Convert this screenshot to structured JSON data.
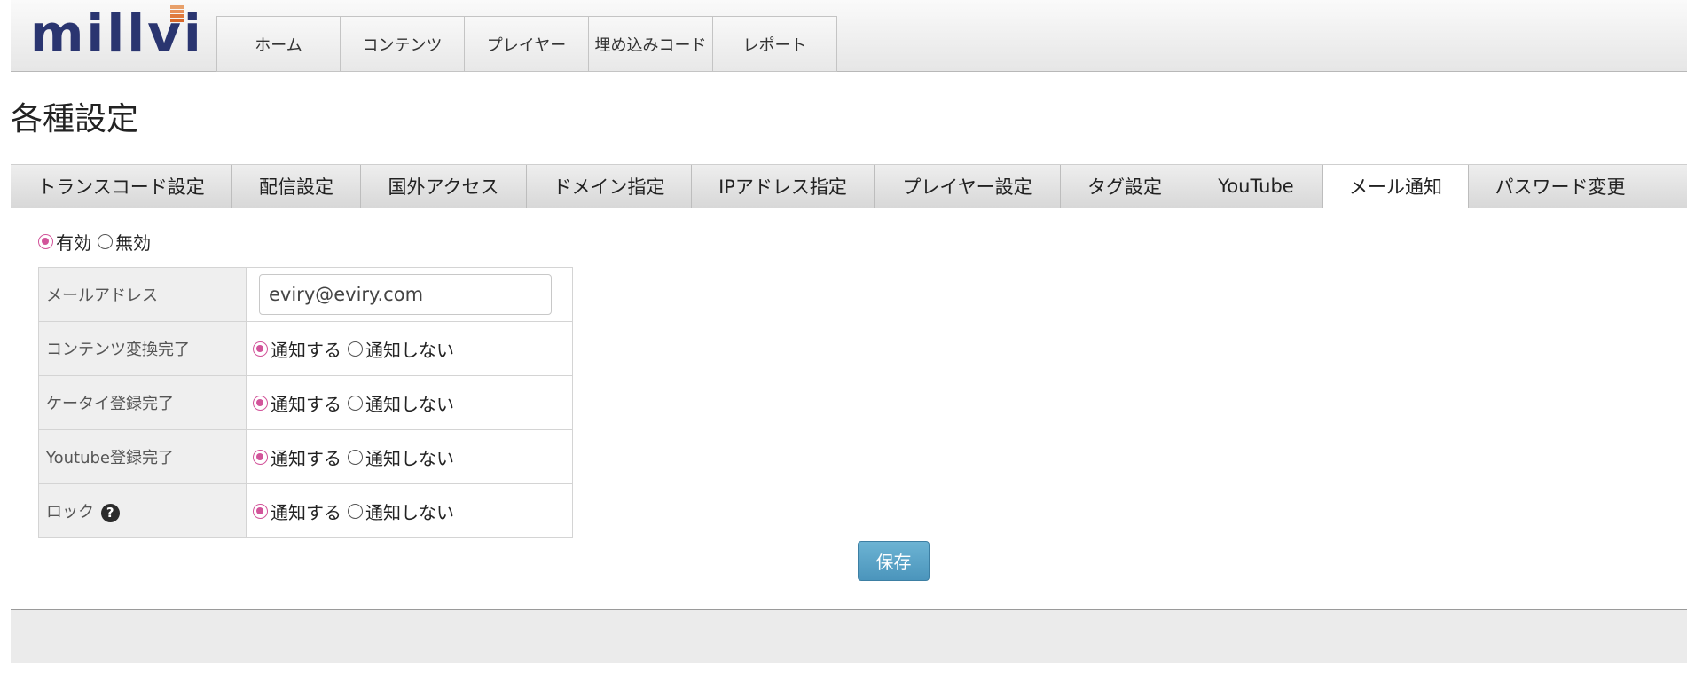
{
  "logo": {
    "text": "millvi",
    "bar_colors": [
      "#e8a06a",
      "#e8905a",
      "#e07a3e",
      "#d8682a"
    ]
  },
  "nav": {
    "items": [
      "ホーム",
      "コンテンツ",
      "プレイヤー",
      "埋め込みコード",
      "レポート"
    ]
  },
  "page_title": "各種設定",
  "tabs": [
    {
      "label": "トランスコード設定",
      "active": false
    },
    {
      "label": "配信設定",
      "active": false
    },
    {
      "label": "国外アクセス",
      "active": false
    },
    {
      "label": "ドメイン指定",
      "active": false
    },
    {
      "label": "IPアドレス指定",
      "active": false
    },
    {
      "label": "プレイヤー設定",
      "active": false
    },
    {
      "label": "タグ設定",
      "active": false
    },
    {
      "label": "YouTube",
      "active": false
    },
    {
      "label": "メール通知",
      "active": true
    },
    {
      "label": "パスワード変更",
      "active": false
    }
  ],
  "enable": {
    "on_label": "有効",
    "off_label": "無効",
    "selected": "on"
  },
  "settings": {
    "email_label": "メールアドレス",
    "email_value": "eviry@eviry.com",
    "notify_label": "通知する",
    "no_notify_label": "通知しない",
    "rows": [
      {
        "label": "コンテンツ変換完了",
        "selected": "notify"
      },
      {
        "label": "ケータイ登録完了",
        "selected": "notify"
      },
      {
        "label": "Youtube登録完了",
        "selected": "notify"
      },
      {
        "label": "ロック",
        "selected": "notify",
        "help": "?"
      }
    ]
  },
  "save_label": "保存",
  "colors": {
    "accent_radio": "#d2549a",
    "save_button": "#5aa3c6",
    "logo_text": "#2a3570"
  }
}
